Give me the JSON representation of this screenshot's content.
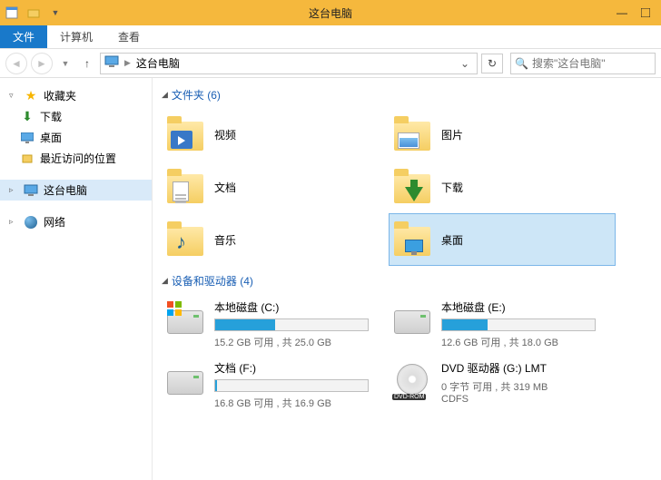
{
  "titlebar": {
    "title": "这台电脑"
  },
  "ribbon": {
    "file": "文件",
    "tabs": [
      "计算机",
      "查看"
    ]
  },
  "address": {
    "path": "这台电脑"
  },
  "search": {
    "placeholder": "搜索\"这台电脑\""
  },
  "sidebar": {
    "favorites": {
      "label": "收藏夹",
      "items": [
        {
          "label": "下载",
          "icon": "download"
        },
        {
          "label": "桌面",
          "icon": "desktop"
        },
        {
          "label": "最近访问的位置",
          "icon": "recent"
        }
      ]
    },
    "thispc": {
      "label": "这台电脑"
    },
    "network": {
      "label": "网络"
    }
  },
  "sections": {
    "folders": {
      "title": "文件夹 (6)",
      "items": [
        {
          "label": "视频",
          "icon": "video"
        },
        {
          "label": "图片",
          "icon": "pictures"
        },
        {
          "label": "文档",
          "icon": "documents"
        },
        {
          "label": "下载",
          "icon": "downloads"
        },
        {
          "label": "音乐",
          "icon": "music"
        },
        {
          "label": "桌面",
          "icon": "desktopf",
          "selected": true
        }
      ]
    },
    "drives": {
      "title": "设备和驱动器 (4)",
      "items": [
        {
          "name": "本地磁盘 (C:)",
          "stat": "15.2 GB 可用 , 共 25.0 GB",
          "fill": 39,
          "sys": true
        },
        {
          "name": "本地磁盘 (E:)",
          "stat": "12.6 GB 可用 , 共 18.0 GB",
          "fill": 30
        },
        {
          "name": "文档 (F:)",
          "stat": "16.8 GB 可用 , 共 16.9 GB",
          "fill": 1
        },
        {
          "name": "DVD 驱动器 (G:) LMT",
          "stat": "0 字节 可用 , 共 319 MB",
          "sub": "CDFS",
          "dvd": true
        }
      ]
    }
  }
}
